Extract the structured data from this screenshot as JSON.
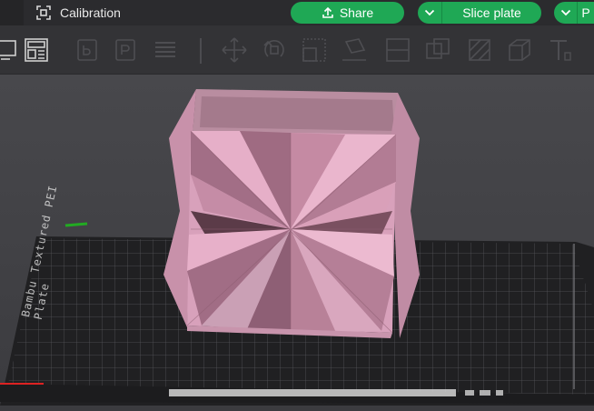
{
  "window": {
    "tab_title": "Calibration",
    "tab_icon": "calibration-icon"
  },
  "actions": {
    "share_label": "Share",
    "share_icon": "upload-icon",
    "slice_label": "Slice plate",
    "print_label": "P"
  },
  "toolbar": {
    "icons": [
      "monitor-icon",
      "layout-icon",
      "add-object-icon",
      "add-plate-icon",
      "arrange-icon",
      "move-icon",
      "rotate-icon",
      "scale-icon",
      "lay-on-face-icon",
      "cut-icon",
      "boolean-icon",
      "support-paint-icon",
      "text-icon"
    ]
  },
  "viewport": {
    "plate_label_line1": "Bambu Textured PEI",
    "plate_label_line2": "Plate"
  },
  "colors": {
    "accent": "#1fa855",
    "model": "#d69ab5",
    "plate": "#232325",
    "background": "#3e3e42"
  }
}
